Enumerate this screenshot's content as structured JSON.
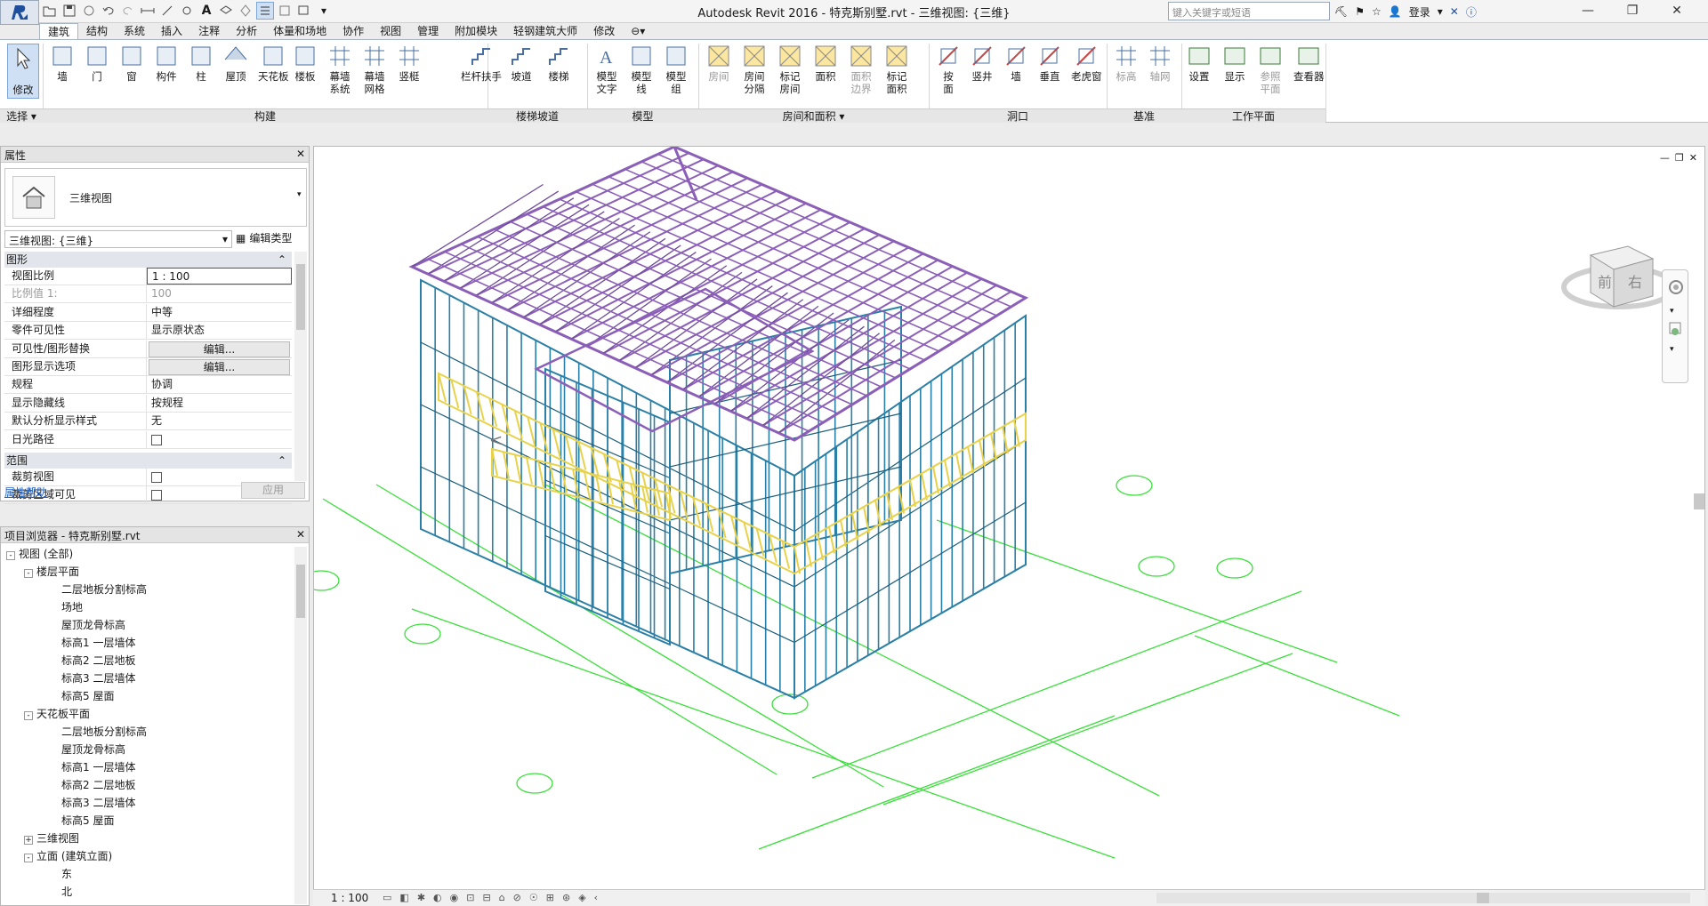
{
  "window": {
    "title": "Autodesk Revit 2016 -    特克斯别墅.rvt - 三维视图: {三维}",
    "search_placeholder": "键入关键字或短语",
    "login": "登录"
  },
  "tabs": [
    "建筑",
    "结构",
    "系统",
    "插入",
    "注释",
    "分析",
    "体量和场地",
    "协作",
    "视图",
    "管理",
    "附加模块",
    "轻钢建筑大师",
    "修改"
  ],
  "ribbon": {
    "select_label": "选择",
    "modify": "修改",
    "build_buttons": [
      "墙",
      "门",
      "窗",
      "构件",
      "柱",
      "屋顶",
      "天花板",
      "楼板",
      "幕墙\n系统",
      "幕墙\n网格",
      "竖梃"
    ],
    "build_panel": "构建",
    "stair_buttons": [
      "栏杆扶手",
      "坡道",
      "楼梯"
    ],
    "stair_panel": "楼梯坡道",
    "model_buttons": [
      "模型\n文字",
      "模型\n线",
      "模型\n组"
    ],
    "model_panel": "模型",
    "room_buttons": [
      "房间",
      "房间\n分隔",
      "标记\n房间",
      "面积",
      "面积\n边界",
      "标记\n面积"
    ],
    "room_panel": "房间和面积",
    "opening_buttons": [
      "按\n面",
      "竖井",
      "墙",
      "垂直",
      "老虎窗"
    ],
    "opening_panel": "洞口",
    "datum_buttons": [
      "标高",
      "轴网"
    ],
    "datum_panel": "基准",
    "work_buttons": [
      "设置",
      "显示",
      "参照\n平面",
      "查看器"
    ],
    "work_panel": "工作平面"
  },
  "properties": {
    "header": "属性",
    "type_name": "三维视图",
    "selector": "三维视图: {三维}",
    "edit_type": "编辑类型",
    "section_graphics": "图形",
    "rows": [
      {
        "k": "视图比例",
        "v": "1 : 100"
      },
      {
        "k": "比例值 1:",
        "v": "100"
      },
      {
        "k": "详细程度",
        "v": "中等"
      },
      {
        "k": "零件可见性",
        "v": "显示原状态"
      },
      {
        "k": "可见性/图形替换",
        "v": "编辑..."
      },
      {
        "k": "图形显示选项",
        "v": "编辑..."
      },
      {
        "k": "规程",
        "v": "协调"
      },
      {
        "k": "显示隐藏线",
        "v": "按规程"
      },
      {
        "k": "默认分析显示样式",
        "v": "无"
      },
      {
        "k": "日光路径",
        "v": ""
      }
    ],
    "section_extent": "范围",
    "extent_rows": [
      {
        "k": "裁剪视图",
        "v": ""
      },
      {
        "k": "裁剪区域可见",
        "v": ""
      }
    ],
    "help": "属性帮助",
    "apply": "应用"
  },
  "browser": {
    "header": "项目浏览器 - 特克斯别墅.rvt",
    "root": "视图 (全部)",
    "floor_plans": "楼层平面",
    "floor_items": [
      "二层地板分割标高",
      "场地",
      "屋顶龙骨标高",
      "标高1 一层墙体",
      "标高2 二层地板",
      "标高3 二层墙体",
      "标高5 屋面"
    ],
    "ceiling_plans": "天花板平面",
    "ceiling_items": [
      "二层地板分割标高",
      "屋顶龙骨标高",
      "标高1 一层墙体",
      "标高2 二层地板",
      "标高3 二层墙体",
      "标高5 屋面"
    ],
    "views3d": "三维视图",
    "elevations": "立面 (建筑立面)",
    "elev_items": [
      "东",
      "北"
    ]
  },
  "viewcube": {
    "front": "前",
    "right": "右"
  },
  "status": {
    "scale": "1 : 100"
  },
  "colors": {
    "roof": "#8b5fb8",
    "wall": "#2a7fa6",
    "floor": "#e8d24a",
    "grid": "#3adf3a"
  }
}
